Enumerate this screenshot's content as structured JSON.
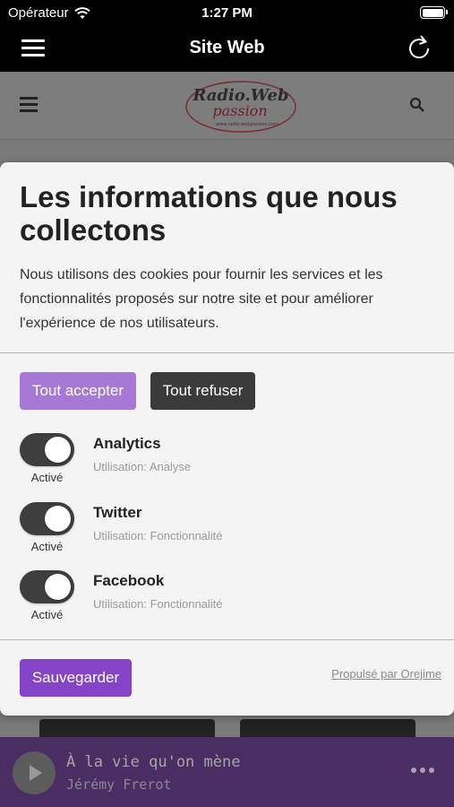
{
  "status_bar": {
    "carrier": "Opérateur",
    "time": "1:27 PM"
  },
  "app_bar": {
    "title": "Site Web"
  },
  "site": {
    "logo_text": "Radio.Web",
    "logo_subtext": "passion",
    "logo_url": "www.radio-webpassion.com"
  },
  "consent": {
    "title": "Les informations que nous collectons",
    "description": "Nous utilisons des cookies pour fournir les services et les fonctionnalités proposés sur notre site et pour améliorer l'expérience de nos utilisateurs.",
    "accept_label": "Tout accepter",
    "refuse_label": "Tout refuser",
    "purposes": [
      {
        "name": "Analytics",
        "usage": "Utilisation: Analyse",
        "state": "Activé"
      },
      {
        "name": "Twitter",
        "usage": "Utilisation: Fonctionnalité",
        "state": "Activé"
      },
      {
        "name": "Facebook",
        "usage": "Utilisation: Fonctionnalité",
        "state": "Activé"
      }
    ],
    "save_label": "Sauvegarder",
    "powered_by": "Propulsé par Orejime"
  },
  "player": {
    "track": "À la vie qu'on mène",
    "artist": "Jérémy Frerot"
  },
  "colors": {
    "accept": "#a779d6",
    "refuse": "#3b3b3b",
    "save": "#8543c7",
    "player_bg": "#4a2d63"
  }
}
